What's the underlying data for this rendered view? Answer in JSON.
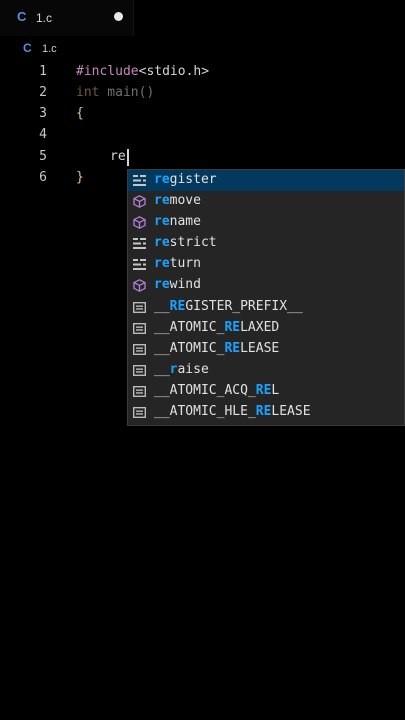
{
  "tab": {
    "lang_icon": "C",
    "filename": "1.c"
  },
  "breadcrumb": {
    "lang_icon": "C",
    "filename": "1.c"
  },
  "lines": [
    {
      "num": "1",
      "text_a": "#include",
      "text_b": "<stdio.h>"
    },
    {
      "num": "2",
      "kw": "int",
      "text": " main()"
    },
    {
      "num": "3",
      "text": "{"
    },
    {
      "num": "4",
      "text": ""
    },
    {
      "num": "5",
      "text": "re"
    },
    {
      "num": "6",
      "text": "}"
    }
  ],
  "suggestions": [
    {
      "match": "re",
      "rest": "gister",
      "pre": "",
      "icon": "keyword-icon"
    },
    {
      "match": "re",
      "rest": "move",
      "pre": "",
      "icon": "function-cube-icon"
    },
    {
      "match": "re",
      "rest": "name",
      "pre": "",
      "icon": "function-cube-icon"
    },
    {
      "match": "re",
      "rest": "strict",
      "pre": "",
      "icon": "keyword-icon"
    },
    {
      "match": "re",
      "rest": "turn",
      "pre": "",
      "icon": "keyword-icon"
    },
    {
      "match": "re",
      "rest": "wind",
      "pre": "",
      "icon": "function-cube-icon"
    },
    {
      "pre": "__",
      "match": "RE",
      "rest": "GISTER_PREFIX__",
      "icon": "text-icon"
    },
    {
      "pre": "__ATOMIC_",
      "match": "RE",
      "rest": "LAXED",
      "icon": "text-icon"
    },
    {
      "pre": "__ATOMIC_",
      "match": "RE",
      "rest": "LEASE",
      "icon": "text-icon"
    },
    {
      "pre": "__",
      "match": "r",
      "rest": "aise",
      "icon": "text-icon"
    },
    {
      "pre": "__ATOMIC_ACQ_",
      "match": "RE",
      "rest": "L",
      "icon": "text-icon"
    },
    {
      "pre": "__ATOMIC_HLE_",
      "match": "RE",
      "rest": "LEASE",
      "icon": "text-icon"
    }
  ],
  "colors": {
    "accent": "#18a3ff",
    "selected": "#04395e",
    "keyword": "#c586c0",
    "c_icon": "#5a8fd8"
  }
}
